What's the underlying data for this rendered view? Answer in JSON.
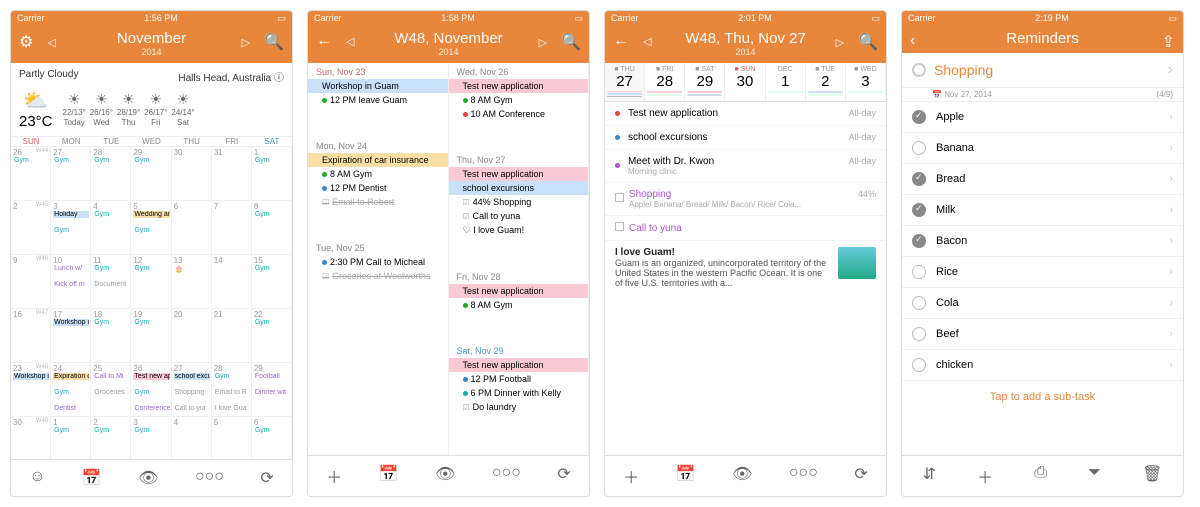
{
  "status": {
    "carrier": "Carrier",
    "wifi": "⋯"
  },
  "screens": [
    {
      "time": "1:56 PM",
      "title": "November",
      "sub": "2014",
      "weather": {
        "cond": "Partly Cloudy",
        "loc": "Halls Head, Australia",
        "temp": "23°C",
        "days": [
          {
            "r": "22/13°",
            "d": "Today"
          },
          {
            "r": "26/16°",
            "d": "Wed"
          },
          {
            "r": "28/19°",
            "d": "Thu"
          },
          {
            "r": "26/17°",
            "d": "Fri"
          },
          {
            "r": "24/14°",
            "d": "Sat"
          }
        ]
      },
      "dow": [
        "SUN",
        "MON",
        "TUE",
        "WED",
        "THU",
        "FRI",
        "SAT"
      ],
      "weeks": [
        [
          {
            "n": 26,
            "w": "W44",
            "ev": [
              {
                "t": "Gym",
                "c": "teal"
              }
            ]
          },
          {
            "n": 27,
            "ev": [
              {
                "t": "Gym",
                "c": "teal"
              }
            ]
          },
          {
            "n": 28,
            "ev": [
              {
                "t": "Gym",
                "c": "teal"
              }
            ]
          },
          {
            "n": 29,
            "ev": [
              {
                "t": "Gym",
                "c": "teal"
              }
            ]
          },
          {
            "n": 30
          },
          {
            "n": 31
          },
          {
            "n": 1,
            "ev": [
              {
                "t": "Gym",
                "c": "teal"
              }
            ]
          }
        ],
        [
          {
            "n": 2,
            "w": "W45"
          },
          {
            "n": 3,
            "ev": [
              {
                "t": "Holiday",
                "c": "blue"
              },
              {
                "t": "Gym",
                "c": "teal"
              }
            ]
          },
          {
            "n": 4,
            "ev": [
              {
                "t": "Gym",
                "c": "teal"
              }
            ]
          },
          {
            "n": 5,
            "ev": [
              {
                "t": "Wedding ani",
                "c": "orange"
              },
              {
                "t": "Gym",
                "c": "teal"
              }
            ]
          },
          {
            "n": 6
          },
          {
            "n": 7
          },
          {
            "n": 8,
            "ev": [
              {
                "t": "Gym",
                "c": "teal"
              }
            ]
          }
        ],
        [
          {
            "n": 9,
            "w": "W46"
          },
          {
            "n": 10,
            "ev": [
              {
                "t": "Lunch w/",
                "c": "pur"
              },
              {
                "t": "Kick off m",
                "c": "pur"
              }
            ]
          },
          {
            "n": 11,
            "ev": [
              {
                "t": "Gym",
                "c": "teal"
              },
              {
                "t": "Document",
                "c": "gray"
              }
            ]
          },
          {
            "n": 12,
            "ev": [
              {
                "t": "Gym",
                "c": "teal"
              }
            ]
          },
          {
            "n": 13,
            "ev": [
              {
                "t": "🎂",
                "c": ""
              }
            ]
          },
          {
            "n": 14
          },
          {
            "n": 15,
            "ev": [
              {
                "t": "Gym",
                "c": "teal"
              }
            ]
          }
        ],
        [
          {
            "n": 16,
            "w": "W47"
          },
          {
            "n": 17,
            "ev": [
              {
                "t": "Workshop in Guam",
                "c": "blue",
                "span": 5
              }
            ]
          },
          {
            "n": 18,
            "ev": [
              {
                "t": "Gym",
                "c": "teal"
              }
            ]
          },
          {
            "n": 19,
            "ev": [
              {
                "t": "Gym",
                "c": "teal"
              }
            ]
          },
          {
            "n": 20
          },
          {
            "n": 21
          },
          {
            "n": 22,
            "ev": [
              {
                "t": "Gym",
                "c": "teal"
              }
            ]
          }
        ],
        [
          {
            "n": 23,
            "w": "W48",
            "ev": [
              {
                "t": "Workshop in",
                "c": "blue"
              }
            ]
          },
          {
            "n": 24,
            "ev": [
              {
                "t": "Expiration of",
                "c": "orange"
              },
              {
                "t": "Gym",
                "c": "teal"
              },
              {
                "t": "Dentist",
                "c": "pur"
              }
            ]
          },
          {
            "n": 25,
            "ev": [
              {
                "t": "Call to Mi",
                "c": "pur"
              },
              {
                "t": "Groceries",
                "c": "gray"
              }
            ]
          },
          {
            "n": 26,
            "ev": [
              {
                "t": "Test new appl",
                "c": "pink"
              },
              {
                "t": "Gym",
                "c": "teal"
              },
              {
                "t": "Conference",
                "c": "pur"
              }
            ]
          },
          {
            "n": 27,
            "ev": [
              {
                "t": "school excu",
                "c": "blue"
              },
              {
                "t": "Shopping",
                "c": "gray"
              },
              {
                "t": "Call to yur",
                "c": "gray"
              }
            ]
          },
          {
            "n": 28,
            "ev": [
              {
                "t": "Gym",
                "c": "teal"
              },
              {
                "t": "Email to R",
                "c": "gray"
              },
              {
                "t": "I love Gua",
                "c": "gray"
              }
            ]
          },
          {
            "n": 29,
            "ev": [
              {
                "t": "Football",
                "c": "pur"
              },
              {
                "t": "Dinner wit",
                "c": "pur"
              }
            ]
          }
        ],
        [
          {
            "n": 30,
            "w": "W49"
          },
          {
            "n": 1,
            "ev": [
              {
                "t": "Gym",
                "c": "teal"
              }
            ]
          },
          {
            "n": 2,
            "ev": [
              {
                "t": "Gym",
                "c": "teal"
              }
            ]
          },
          {
            "n": 3,
            "ev": [
              {
                "t": "Gym",
                "c": "teal"
              }
            ]
          },
          {
            "n": 4
          },
          {
            "n": 5
          },
          {
            "n": 6,
            "ev": [
              {
                "t": "Gym",
                "c": "teal"
              }
            ]
          }
        ]
      ]
    },
    {
      "time": "1:58 PM",
      "title": "W48, November",
      "sub": "2014",
      "cols": [
        {
          "head": "Sun, Nov 23",
          "cls": "sunhead",
          "items": [
            {
              "t": "Workshop in Guam",
              "c": "blue"
            },
            {
              "t": "12 PM leave Guam",
              "dot": "dg"
            }
          ]
        },
        {
          "head": "Wed, Nov 26",
          "items": [
            {
              "t": "Test new application",
              "c": "pink"
            },
            {
              "t": "8 AM Gym",
              "dot": "dg"
            },
            {
              "t": "10 AM Conference",
              "dot": "dr"
            }
          ]
        },
        {
          "head": "Mon, Nov 24",
          "items": [
            {
              "t": "Expiration of car insurance",
              "c": "orange"
            },
            {
              "t": "8 AM Gym",
              "dot": "dg"
            },
            {
              "t": "12 PM Dentist",
              "dot": "db"
            },
            {
              "t": "Email to Robert",
              "chk": true,
              "strike": true
            }
          ]
        },
        {
          "head": "Thu, Nov 27",
          "items": [
            {
              "t": "Test new application",
              "c": "pink"
            },
            {
              "t": "school excursions",
              "c": "blue"
            },
            {
              "t": "44% Shopping",
              "chk": true
            },
            {
              "t": "Call to yuna",
              "chk": true
            },
            {
              "t": "I love Guam!",
              "heart": true
            }
          ]
        },
        {
          "head": "Tue, Nov 25",
          "items": [
            {
              "t": "2:30 PM Call to Micheal",
              "dot": "db"
            },
            {
              "t": "Groceries at Woolworths",
              "chk": true,
              "strike": true
            }
          ]
        },
        {
          "head": "Fri, Nov 28",
          "items": [
            {
              "t": "Test new application",
              "c": "pink"
            },
            {
              "t": "8 AM Gym",
              "dot": "dg"
            }
          ]
        },
        {
          "head": "",
          "items": []
        },
        {
          "head": "Sat, Nov 29",
          "cls": "sathead",
          "items": [
            {
              "t": "Test new application",
              "c": "pink"
            },
            {
              "t": "12 PM Football",
              "dot": "db"
            },
            {
              "t": "6 PM Dinner with Kelly",
              "dot": "dt"
            },
            {
              "t": "Do laundry",
              "chk": true
            }
          ]
        }
      ]
    },
    {
      "time": "2:01 PM",
      "title": "W48, Thu, Nov 27",
      "sub": "2014",
      "strip": [
        {
          "wd": "THU",
          "n": "27",
          "sel": true,
          "bars": [
            "#f9c9d6",
            "#c9e0f9",
            "#bbb"
          ]
        },
        {
          "wd": "FRI",
          "n": "28",
          "bars": [
            "#f9c9d6",
            "#dfe"
          ]
        },
        {
          "wd": "SAT",
          "n": "29",
          "bars": [
            "#f9c9d6",
            "#cde"
          ]
        },
        {
          "wd": "SUN",
          "n": "30",
          "sun": true
        },
        {
          "wd": "MON",
          "mon": "DEC",
          "n": "1",
          "bars": [
            "#dfe"
          ]
        },
        {
          "wd": "TUE",
          "n": "2",
          "bars": [
            "#cde",
            "#dfe"
          ]
        },
        {
          "wd": "WED",
          "n": "3",
          "bars": [
            "#dfe"
          ]
        }
      ],
      "events": [
        {
          "t": "Test new application",
          "dot": "#d44",
          "meta": "All-day"
        },
        {
          "t": "school excursions",
          "dot": "#38c",
          "meta": "All-day"
        },
        {
          "t": "Meet with Dr. Kwon",
          "dot": "#a5c",
          "meta": "All-day",
          "sub": "Morning clinic"
        },
        {
          "t": "Shopping",
          "box": true,
          "meta": "44%",
          "sub": "Apple/ Banana/ Bread/ Milk/ Bacon/ Rice/ Cola...",
          "pur": true
        },
        {
          "t": "Call to yuna",
          "box": true,
          "pur": true
        }
      ],
      "note": {
        "t": "I love Guam!",
        "b": "Guam is an organized, unincorporated territory of the United States in the western Pacific Ocean. It is one of five U.S. territories with a..."
      }
    },
    {
      "time": "2:19 PM",
      "title": "Reminders",
      "list": {
        "name": "Shopping",
        "date": "Nov 27, 2014",
        "count": "(4/9)"
      },
      "items": [
        {
          "t": "Apple",
          "d": true
        },
        {
          "t": "Banana"
        },
        {
          "t": "Bread",
          "d": true
        },
        {
          "t": "Milk",
          "d": true
        },
        {
          "t": "Bacon",
          "d": true
        },
        {
          "t": "Rice"
        },
        {
          "t": "Cola"
        },
        {
          "t": "Beef"
        },
        {
          "t": "chicken"
        }
      ],
      "add": "Tap to add a sub-task"
    }
  ],
  "toolbar1": [
    "☺",
    "📅",
    "👁",
    "○○○",
    "⟳"
  ],
  "toolbar2": [
    "＋",
    "📅",
    "👁",
    "○○○",
    "⟳"
  ],
  "toolbar4": [
    "⇵",
    "＋",
    "⎙",
    "⏷",
    "🗑"
  ]
}
